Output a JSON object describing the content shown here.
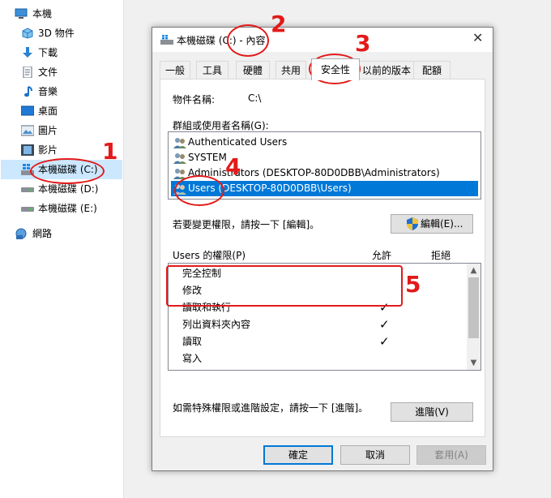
{
  "nav": {
    "items": [
      {
        "label": "本機",
        "icon": "computer-icon"
      },
      {
        "label": "3D 物件",
        "icon": "cube-3d-icon"
      },
      {
        "label": "下載",
        "icon": "download-arrow-icon"
      },
      {
        "label": "文件",
        "icon": "document-icon"
      },
      {
        "label": "音樂",
        "icon": "music-note-icon"
      },
      {
        "label": "桌面",
        "icon": "desktop-icon"
      },
      {
        "label": "圖片",
        "icon": "pictures-icon"
      },
      {
        "label": "影片",
        "icon": "video-film-icon"
      },
      {
        "label": "本機磁碟 (C:)",
        "icon": "windows-drive-icon"
      },
      {
        "label": "本機磁碟 (D:)",
        "icon": "drive-icon"
      },
      {
        "label": "本機磁碟 (E:)",
        "icon": "drive-icon"
      },
      {
        "label": "網路",
        "icon": "network-icon"
      }
    ],
    "selected": "本機磁碟 (C:)"
  },
  "dialog": {
    "title": "本機磁碟 (C:) - 內容",
    "close_glyph": "✕",
    "tabs": [
      "一般",
      "工具",
      "硬體",
      "共用",
      "安全性",
      "以前的版本",
      "配額"
    ],
    "active_tab": "安全性",
    "object_name_label": "物件名稱:",
    "object_name_value": "C:\\",
    "groups_label": "群組或使用者名稱(G):",
    "groups": [
      "Authenticated Users",
      "SYSTEM",
      "Administrators (DESKTOP-80D0DBB\\Administrators)",
      "Users (DESKTOP-80D0DBB\\Users)"
    ],
    "selected_group": "Users (DESKTOP-80D0DBB\\Users)",
    "change_hint": "若要變更權限，請按一下 [編輯]。",
    "edit_button": "編輯(E)...",
    "perm_header": "Users 的權限(P)",
    "allow_header": "允許",
    "deny_header": "拒絕",
    "permissions": [
      {
        "name": "完全控制",
        "allow": "",
        "deny": ""
      },
      {
        "name": "修改",
        "allow": "",
        "deny": ""
      },
      {
        "name": "讀取和執行",
        "allow": "✓",
        "deny": ""
      },
      {
        "name": "列出資料夾內容",
        "allow": "✓",
        "deny": ""
      },
      {
        "name": "讀取",
        "allow": "✓",
        "deny": ""
      },
      {
        "name": "寫入",
        "allow": "",
        "deny": ""
      }
    ],
    "advanced_hint": "如需特殊權限或進階設定，請按一下 [進階]。",
    "advanced_button": "進階(V)",
    "ok_button": "確定",
    "cancel_button": "取消",
    "apply_button": "套用(A)"
  },
  "annotations": [
    "1",
    "2",
    "3",
    "4",
    "5"
  ],
  "colors": {
    "accent": "#0078d7",
    "annotation": "#e21a1a",
    "selection": "#cce8ff"
  }
}
